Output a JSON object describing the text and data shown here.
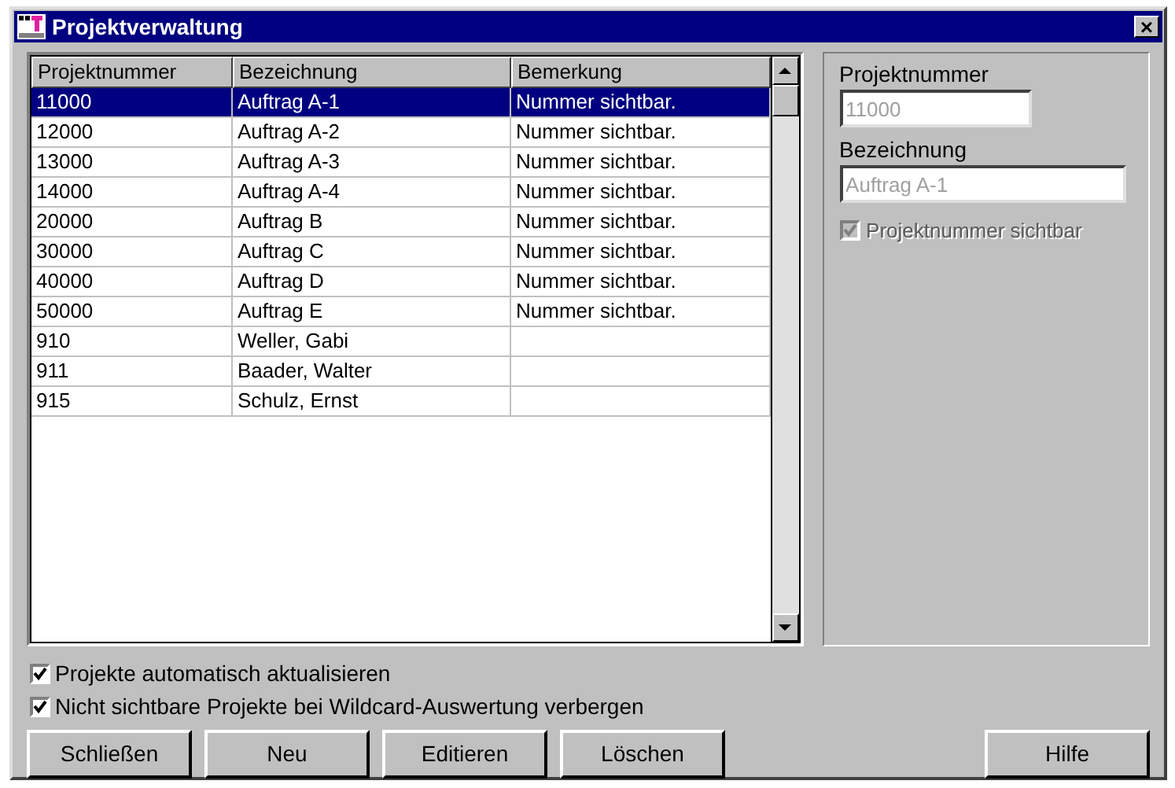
{
  "window": {
    "title": "Projektverwaltung",
    "close": "×"
  },
  "table": {
    "columns": [
      "Projektnummer",
      "Bezeichnung",
      "Bemerkung"
    ],
    "rows": [
      {
        "cells": [
          "11000",
          "Auftrag A-1",
          "Nummer sichtbar."
        ],
        "selected": true
      },
      {
        "cells": [
          "12000",
          "Auftrag A-2",
          "Nummer sichtbar."
        ],
        "selected": false
      },
      {
        "cells": [
          "13000",
          "Auftrag A-3",
          "Nummer sichtbar."
        ],
        "selected": false
      },
      {
        "cells": [
          "14000",
          "Auftrag A-4",
          "Nummer sichtbar."
        ],
        "selected": false
      },
      {
        "cells": [
          "20000",
          "Auftrag B",
          "Nummer sichtbar."
        ],
        "selected": false
      },
      {
        "cells": [
          "30000",
          "Auftrag C",
          "Nummer sichtbar."
        ],
        "selected": false
      },
      {
        "cells": [
          "40000",
          "Auftrag D",
          "Nummer sichtbar."
        ],
        "selected": false
      },
      {
        "cells": [
          "50000",
          "Auftrag E",
          "Nummer sichtbar."
        ],
        "selected": false
      },
      {
        "cells": [
          "910",
          "Weller, Gabi",
          ""
        ],
        "selected": false
      },
      {
        "cells": [
          "911",
          "Baader, Walter",
          ""
        ],
        "selected": false
      },
      {
        "cells": [
          "915",
          "Schulz, Ernst",
          ""
        ],
        "selected": false
      }
    ]
  },
  "details": {
    "fields": [
      {
        "label": "Projektnummer",
        "value": "11000",
        "disabled": true
      },
      {
        "label": "Bezeichnung",
        "value": "Auftrag A-1",
        "disabled": true
      }
    ],
    "checkbox": {
      "label": "Projektnummer sichtbar",
      "checked": true,
      "disabled": true
    }
  },
  "options": [
    {
      "label": "Projekte automatisch aktualisieren",
      "checked": true
    },
    {
      "label": "Nicht sichtbare Projekte bei Wildcard-Auswertung verbergen",
      "checked": true
    }
  ],
  "buttons": [
    "Schließen",
    "Neu",
    "Editieren",
    "Löschen"
  ],
  "help_button": "Hilfe"
}
